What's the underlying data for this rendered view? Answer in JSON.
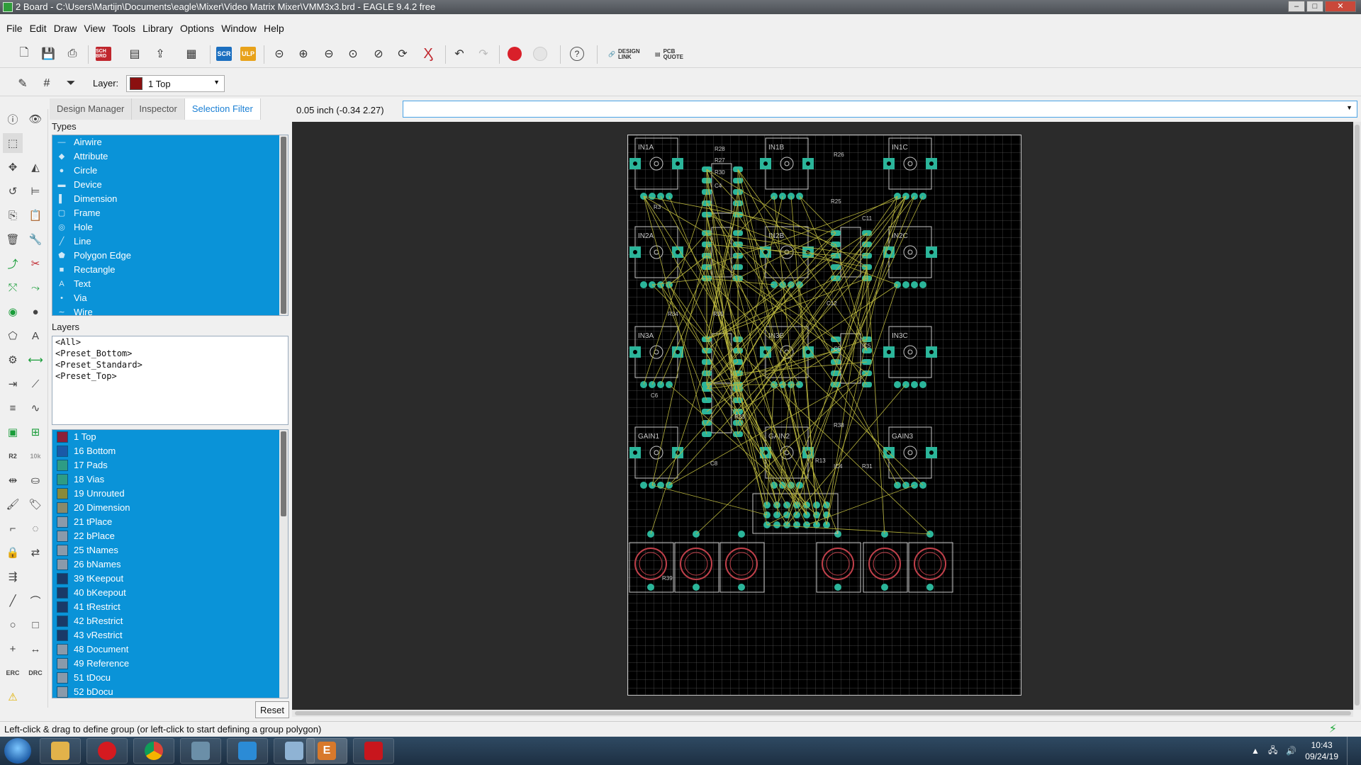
{
  "window": {
    "title": "2 Board - C:\\Users\\Martijn\\Documents\\eagle\\Mixer\\Video Matrix Mixer\\VMM3x3.brd - EAGLE 9.4.2 free",
    "controls": {
      "minimize": "–",
      "maximize": "□",
      "close": "✕"
    }
  },
  "menu": [
    "File",
    "Edit",
    "Draw",
    "View",
    "Tools",
    "Library",
    "Options",
    "Window",
    "Help"
  ],
  "toolbar": {
    "scr_label": "SCR",
    "ulp_label": "ULP",
    "sch_label": "SCH BRD",
    "design_link_label": "DESIGN LINK",
    "pcb_quote_label": "PCB QUOTE",
    "help_label": "?",
    "layer_label": "Layer:",
    "layer_value": "1 Top",
    "layer_color": "#8b1010"
  },
  "panel": {
    "tabs": [
      "Design Manager",
      "Inspector",
      "Selection Filter"
    ],
    "active_tab": "Selection Filter",
    "types_title": "Types",
    "types": [
      {
        "label": "Airwire",
        "icon": "airwire-icon"
      },
      {
        "label": "Attribute",
        "icon": "attribute-icon"
      },
      {
        "label": "Circle",
        "icon": "circle-icon"
      },
      {
        "label": "Device",
        "icon": "device-icon"
      },
      {
        "label": "Dimension",
        "icon": "dimension-icon"
      },
      {
        "label": "Frame",
        "icon": "frame-icon"
      },
      {
        "label": "Hole",
        "icon": "hole-icon"
      },
      {
        "label": "Line",
        "icon": "line-icon"
      },
      {
        "label": "Polygon Edge",
        "icon": "polygon-icon"
      },
      {
        "label": "Rectangle",
        "icon": "rectangle-icon"
      },
      {
        "label": "Text",
        "icon": "text-icon"
      },
      {
        "label": "Via",
        "icon": "via-icon"
      },
      {
        "label": "Wire",
        "icon": "wire-icon"
      }
    ],
    "layers_title": "Layers",
    "presets": [
      "<All>",
      "<Preset_Bottom>",
      "<Preset_Standard>",
      "<Preset_Top>"
    ],
    "layers": [
      {
        "label": "1 Top",
        "color": "#8b2038"
      },
      {
        "label": "16 Bottom",
        "color": "#1a5aa8"
      },
      {
        "label": "17 Pads",
        "color": "#2e9c84"
      },
      {
        "label": "18 Vias",
        "color": "#2e9c84"
      },
      {
        "label": "19 Unrouted",
        "color": "#8a8a3a"
      },
      {
        "label": "20 Dimension",
        "color": "#8a8a6a"
      },
      {
        "label": "21 tPlace",
        "color": "#8a9aaa"
      },
      {
        "label": "22 bPlace",
        "color": "#8a9aaa"
      },
      {
        "label": "25 tNames",
        "color": "#8a9aaa"
      },
      {
        "label": "26 bNames",
        "color": "#8a9aaa"
      },
      {
        "label": "39 tKeepout",
        "color": "#1a3a68"
      },
      {
        "label": "40 bKeepout",
        "color": "#1a3a68"
      },
      {
        "label": "41 tRestrict",
        "color": "#1a3a68"
      },
      {
        "label": "42 bRestrict",
        "color": "#1a3a68"
      },
      {
        "label": "43 vRestrict",
        "color": "#1a3a68"
      },
      {
        "label": "48 Document",
        "color": "#8a9aaa"
      },
      {
        "label": "49 Reference",
        "color": "#8a9aaa"
      },
      {
        "label": "51 tDocu",
        "color": "#8a9aaa"
      },
      {
        "label": "52 bDocu",
        "color": "#8a9aaa"
      }
    ],
    "reset_label": "Reset"
  },
  "coordinates": "0.05 inch (-0.34 2.27)",
  "command_value": "",
  "board": {
    "jacks": [
      "IN1A",
      "IN1B",
      "IN1C",
      "IN2A",
      "IN2B",
      "IN2C",
      "IN3A",
      "IN3B",
      "IN3C",
      "GAIN1",
      "GAIN2",
      "GAIN3"
    ],
    "labels": [
      "R28",
      "R27",
      "R30",
      "R26",
      "R3",
      "R25",
      "C11",
      "C12",
      "R34",
      "R35",
      "C6",
      "C5",
      "C8",
      "R33",
      "R38",
      "R13",
      "R31",
      "R39",
      "C4",
      "IC4",
      "IC5"
    ]
  },
  "status": "Left-click & drag to define group (or left-click to start defining a group polygon)",
  "taskbar": {
    "time": "10:43",
    "date": "09/24/19"
  }
}
